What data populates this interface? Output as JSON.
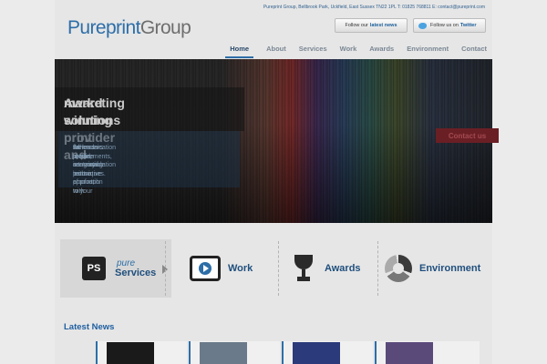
{
  "header": {
    "logo": {
      "primary": "Pureprint",
      "secondary": "Group"
    },
    "address": "Pureprint Group, Bellbrook Park, Uckfield, East Sussex TN22 1PL    T: 01825 768811    E: contact@pureprint.com",
    "news_button": {
      "prefix": "Follow our",
      "bold": "latest news"
    },
    "twitter_button": {
      "prefix": "Follow us on",
      "bold": "Twitter"
    }
  },
  "nav": {
    "items": [
      {
        "label": "Home",
        "active": true
      },
      {
        "label": "About"
      },
      {
        "label": "Services"
      },
      {
        "label": "Work"
      },
      {
        "label": "Awards"
      },
      {
        "label": "Environment"
      },
      {
        "label": "Contact"
      }
    ]
  },
  "hero": {
    "title_line1": "Award winning print and",
    "title_line2": "marketing solutions provider",
    "copy": [
      "As leaders in sustainable print production",
      "we provide an innovative approach to your",
      "communication requirements, integrating",
      "the tactile, sensory nature of print, with",
      "full cross-media communication techniques."
    ],
    "cta": "Contact us"
  },
  "features": {
    "services": {
      "icon_text": "PS",
      "prefix": "pure",
      "label": "Services"
    },
    "work": {
      "label": "Work"
    },
    "awards": {
      "label": "Awards"
    },
    "environment": {
      "label": "Environment"
    }
  },
  "news": {
    "title": "Latest News",
    "thumb_colors": [
      "#1a1a1a",
      "#6a7a8a",
      "#2a3a7a",
      "#5a4a7a"
    ]
  }
}
